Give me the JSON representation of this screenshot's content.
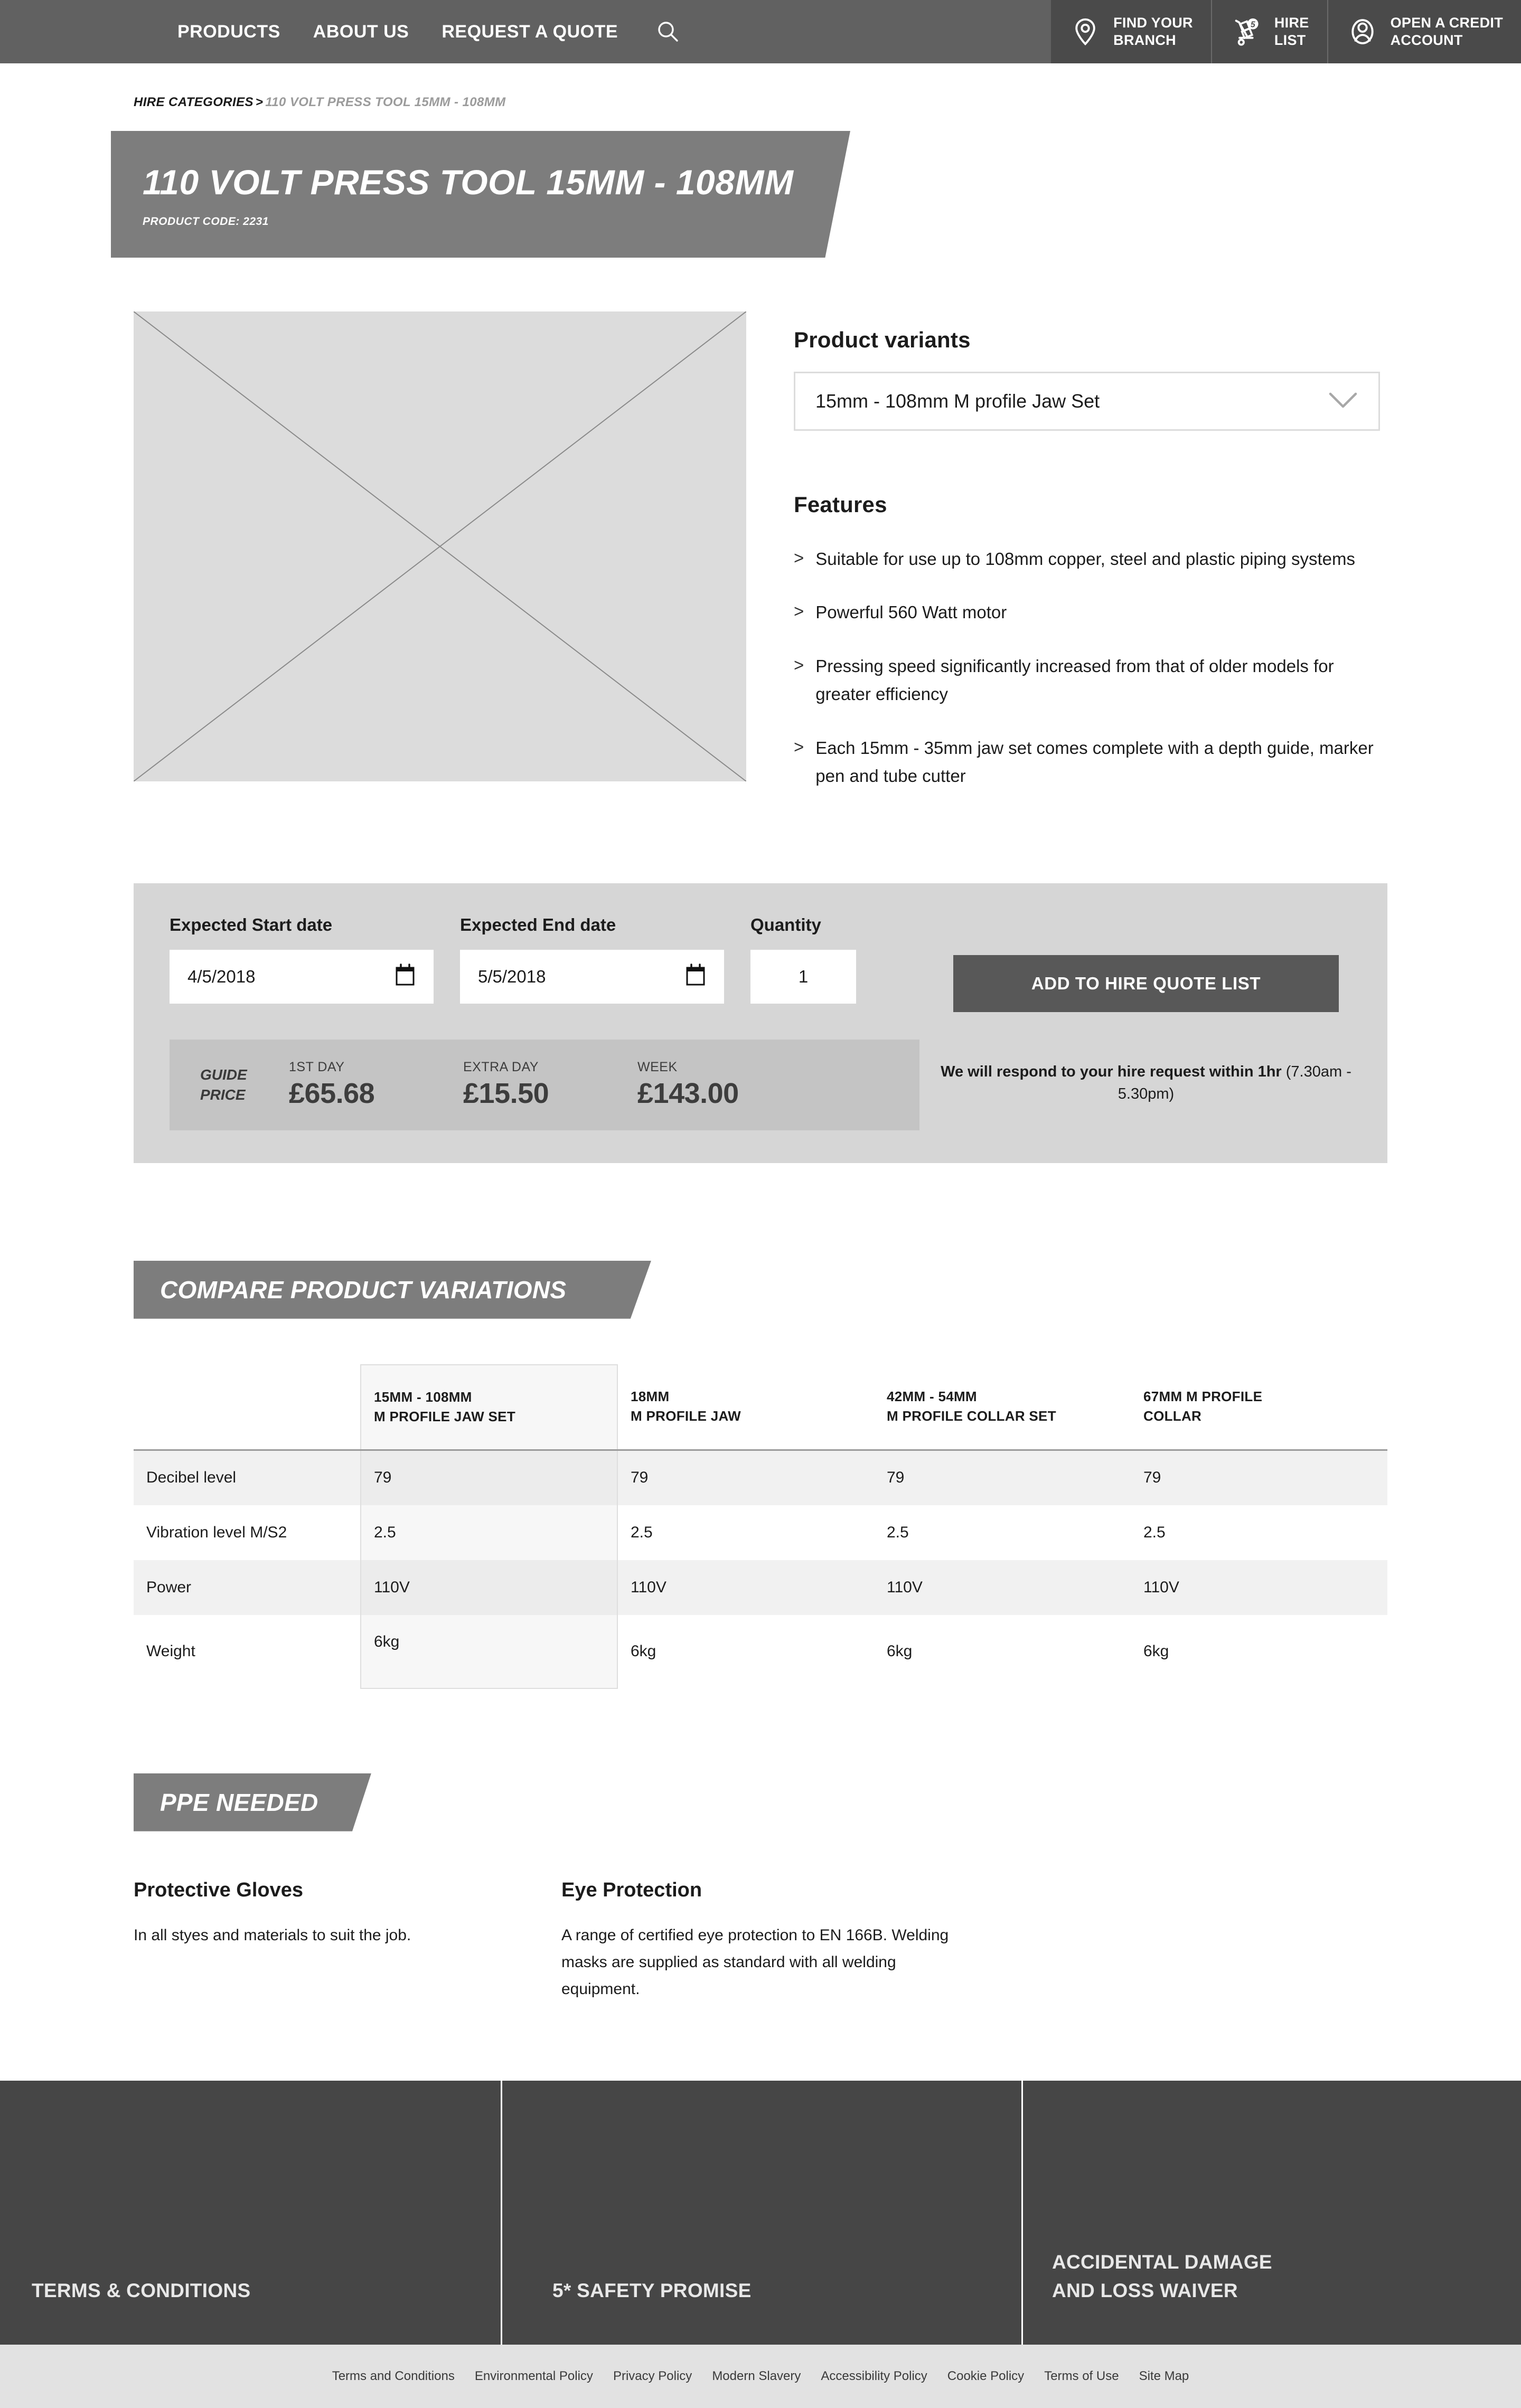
{
  "header": {
    "nav": [
      {
        "label": "PRODUCTS"
      },
      {
        "label": "ABOUT US"
      },
      {
        "label": "REQUEST A QUOTE"
      }
    ],
    "search_icon": "search-icon",
    "actions": [
      {
        "icon": "location-pin-icon",
        "label": "FIND YOUR\nBRANCH",
        "badge": ""
      },
      {
        "icon": "hand-truck-icon",
        "label": "HIRE\nLIST",
        "badge": "5"
      },
      {
        "icon": "user-account-icon",
        "label": "OPEN A CREDIT\nACCOUNT",
        "badge": ""
      }
    ]
  },
  "breadcrumb": {
    "parent": "HIRE CATEGORIES",
    "separator": ">",
    "current": "110 VOLT PRESS TOOL 15MM - 108MM"
  },
  "title_banner": {
    "title": "110 VOLT PRESS TOOL 15MM - 108MM",
    "product_code": "PRODUCT CODE: 2231"
  },
  "product": {
    "image_alt": "product-image-placeholder",
    "variants_heading": "Product variants",
    "selected_variant": "15mm - 108mm M profile Jaw Set",
    "features_heading": "Features",
    "features": [
      "Suitable for use up to 108mm copper, steel and plastic piping systems",
      "Powerful 560 Watt motor",
      "Pressing speed significantly increased from that of older models for greater efficiency",
      "Each 15mm - 35mm jaw set comes complete with a depth guide, marker pen and tube cutter"
    ]
  },
  "booking": {
    "start_date_label": "Expected Start date",
    "start_date_value": "4/5/2018",
    "end_date_label": "Expected End date",
    "end_date_value": "5/5/2018",
    "quantity_label": "Quantity",
    "quantity_value": "1",
    "add_button": "ADD TO HIRE QUOTE LIST",
    "respond_bold": "We will respond to your hire request within 1hr",
    "respond_rest": " (7.30am - 5.30pm)",
    "guide_price_label_line1": "GUIDE",
    "guide_price_label_line2": "PRICE",
    "prices": [
      {
        "term": "1ST DAY",
        "amount": "£65.68"
      },
      {
        "term": "EXTRA DAY",
        "amount": "£15.50"
      },
      {
        "term": "WEEK",
        "amount": "£143.00"
      }
    ]
  },
  "compare": {
    "heading": "COMPARE PRODUCT VARIATIONS",
    "columns": [
      {
        "line1": "15MM - 108MM",
        "line2": "M PROFILE JAW SET"
      },
      {
        "line1": "18MM",
        "line2": "M PROFILE JAW"
      },
      {
        "line1": "42MM - 54MM",
        "line2": "M PROFILE COLLAR SET"
      },
      {
        "line1": "67MM M PROFILE",
        "line2": "COLLAR"
      }
    ],
    "rows": [
      {
        "label": "Decibel level",
        "values": [
          "79",
          "79",
          "79",
          "79"
        ]
      },
      {
        "label": "Vibration level M/S2",
        "values": [
          "2.5",
          "2.5",
          "2.5",
          "2.5"
        ]
      },
      {
        "label": "Power",
        "values": [
          "110V",
          "110V",
          "110V",
          "110V"
        ]
      },
      {
        "label": "Weight",
        "values": [
          "6kg",
          "6kg",
          "6kg",
          "6kg"
        ]
      }
    ]
  },
  "ppe": {
    "heading": "PPE NEEDED",
    "items": [
      {
        "title": "Protective Gloves",
        "body": "In all styes and materials to suit the job."
      },
      {
        "title": "Eye Protection",
        "body": "A range of certified eye protection to EN 166B. Welding masks are supplied as standard with all welding equipment."
      }
    ]
  },
  "footer": {
    "promos": [
      {
        "label": "TERMS & CONDITIONS"
      },
      {
        "label": "5* SAFETY PROMISE"
      },
      {
        "label": "ACCIDENTAL DAMAGE\nAND LOSS WAIVER"
      }
    ],
    "links": [
      "Terms and Conditions",
      "Environmental Policy",
      "Privacy Policy",
      "Modern Slavery",
      "Accessibility Policy",
      "Cookie Policy",
      "Terms of Use",
      "Site Map"
    ]
  },
  "colors": {
    "header_bg": "#616161",
    "header_action_bg": "#4a4a4a",
    "banner_gray": "#7d7d7d",
    "panel_gray": "#d6d6d6",
    "price_gray": "#c4c4c4",
    "button_gray": "#585858",
    "footer_dark": "#464646",
    "footer_links_bg": "#e2e2e2"
  }
}
